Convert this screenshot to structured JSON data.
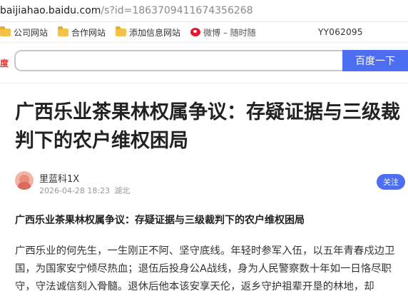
{
  "address_bar": {
    "host": "baijiahao.baidu.com",
    "path": "/s?id=1863709411674356268"
  },
  "bookmarks": {
    "items": [
      {
        "label": "公司网站",
        "icon": "folder-icon"
      },
      {
        "label": "合作网站",
        "icon": "folder-icon"
      },
      {
        "label": "添加信息网站",
        "icon": "folder-icon"
      },
      {
        "label": "微博 – 随时随",
        "icon": "weibo-icon"
      }
    ],
    "user_tag": "YY062095"
  },
  "search": {
    "logo_fragment": "度",
    "button_label": "百度一下",
    "placeholder": ""
  },
  "article": {
    "title": "广西乐业茶果林权属争议：存疑证据与三级裁判下的农户维权困局",
    "author": "里蓝科1X",
    "date": "2026-04-28 18:23",
    "location": "湖北",
    "follow_label": "关注",
    "subtitle": "广西乐业茶果林权属争议：存疑证据与三级裁判下的农户维权困局",
    "body": "广西乐业的何先生，一生刚正不阿、坚守底线。年轻时参军入伍，以五年青春戍边卫国，为国家安宁倾尽热血；退伍后投身公A战线，身为人民警察数十年如一日恪尽职守，守法诚信刻入骨髓。退休后他本该安享天伦，返乡守护祖辈开垦的林地，却"
  }
}
